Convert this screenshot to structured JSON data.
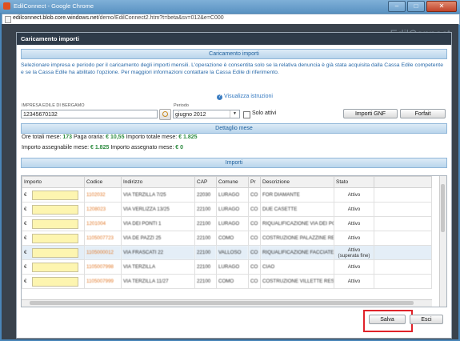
{
  "browser": {
    "window_title": "EdilConnect - Google Chrome",
    "url_host": "edilconnect.blob.core.windows.net",
    "url_path": "/demo/EdilConnect2.htm?t=beta&sv=012&e=C000"
  },
  "brand": "EdilConnect",
  "dialog": {
    "title": "Caricamento importi",
    "section_top": "Caricamento importi",
    "info_text": "Selezionare impresa e periodo per il caricamento degli importi mensili. L'operazione è consentita solo se la relativa denuncia è già stata acquisita dalla Cassa Edile competente e se la Cassa Edile ha abilitato l'opzione. Per maggiori informazioni contattare la Cassa Edile di riferimento.",
    "istruzioni_link": "Visualizza istruzioni",
    "impresa_label": "IMPRESA EDILE DI BERGAMO",
    "impresa_value": "12345670132",
    "periodo_label": "Periodo",
    "periodo_value": "giugno 2012",
    "solo_attivi_label": "Solo attivi",
    "btn_importi_gnf": "Importi GNF",
    "btn_forfait": "Forfait",
    "section_dettaglio": "Dettaglio mese",
    "ore_totali_label": "Ore totali mese:",
    "ore_totali_value": "173",
    "paga_oraria_label": "Paga oraria:",
    "paga_oraria_value": "€ 10,55",
    "importo_totale_label": "Importo totale mese:",
    "importo_totale_value": "€ 1.825",
    "importo_assegnabile_label": "Importo assegnabile mese:",
    "importo_assegnabile_value": "€ 1.825",
    "importo_assegnato_label": "Importo assegnato mese:",
    "importo_assegnato_value": "€ 0",
    "section_importi": "Importi",
    "columns": [
      "Importo",
      "Codice",
      "Indirizzo",
      "CAP",
      "Comune",
      "Pr",
      "Descrizione",
      "Stato"
    ],
    "currency_symbol": "€",
    "rows": [
      {
        "codice": "1102032",
        "indirizzo": "VIA TERZILLA 7/25",
        "cap": "22030",
        "comune": "LURAGO",
        "pr": "CO",
        "descrizione": "FOR DIAMANTE",
        "stato": "Attivo",
        "stato2": ""
      },
      {
        "codice": "1208023",
        "indirizzo": "VIA VERLIZZA 13/25",
        "cap": "22100",
        "comune": "LURAGO",
        "pr": "CO",
        "descrizione": "DUE CASETTE",
        "stato": "Attivo",
        "stato2": ""
      },
      {
        "codice": "1201004",
        "indirizzo": "VIA DEI PONTI 1",
        "cap": "22100",
        "comune": "LURAGO",
        "pr": "CO",
        "descrizione": "RIQUALIFICAZIONE VIA DEI PONTI",
        "stato": "Attivo",
        "stato2": ""
      },
      {
        "codice": "1105007723",
        "indirizzo": "VIA DE PAZZI 25",
        "cap": "22100",
        "comune": "COMO",
        "pr": "CO",
        "descrizione": "COSTRUZIONE PALAZZINE RESIDENZIALI",
        "stato": "Attivo",
        "stato2": ""
      },
      {
        "codice": "1105000012",
        "indirizzo": "VIA FRASCATI 22",
        "cap": "22100",
        "comune": "VALLOSO",
        "pr": "CO",
        "descrizione": "RIQUALIFICAZIONE FACCIATE",
        "stato": "Attivo",
        "stato2": "(superata fine)"
      },
      {
        "codice": "1105007998",
        "indirizzo": "VIA TERZILLA",
        "cap": "22100",
        "comune": "LURAGO",
        "pr": "CO",
        "descrizione": "CIAO",
        "stato": "Attivo",
        "stato2": ""
      },
      {
        "codice": "1105007999",
        "indirizzo": "VIA TERZILLA 11/27",
        "cap": "22100",
        "comune": "COMO",
        "pr": "CO",
        "descrizione": "COSTRUZIONE VILLETTE RESIDENZIALI",
        "stato": "Attivo",
        "stato2": ""
      }
    ],
    "btn_salva": "Salva",
    "btn_esci": "Esci"
  },
  "colors": {
    "section_text": "#1d5f9c",
    "info_text": "#2768a8",
    "value_green": "#2b8a3e",
    "code_orange": "#e27a2a",
    "highlight_red": "#e0232a",
    "input_yellow": "#fdf5b0"
  }
}
